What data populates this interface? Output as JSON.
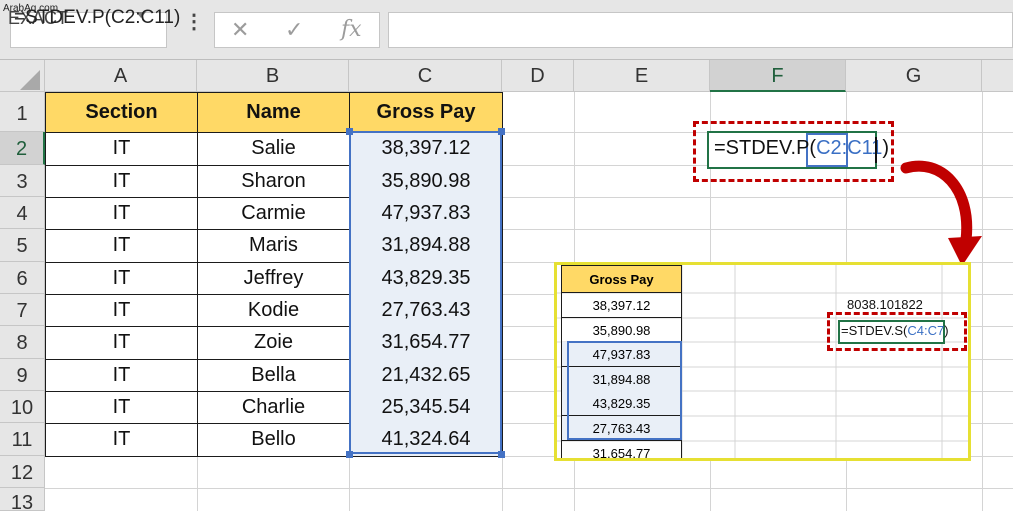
{
  "watermark": "ArabAq.com",
  "formula_bar": {
    "name_box": "EXACT",
    "cancel_icon": "✕",
    "enter_icon": "✓",
    "fx_label": "fx",
    "formula": "=STDEV.P(C2:C11)"
  },
  "columns": [
    "A",
    "B",
    "C",
    "D",
    "E",
    "F",
    "G"
  ],
  "rows": [
    "1",
    "2",
    "3",
    "4",
    "5",
    "6",
    "7",
    "8",
    "9",
    "10",
    "11",
    "12",
    "13"
  ],
  "table": {
    "headers": [
      "Section",
      "Name",
      "Gross Pay"
    ],
    "data": [
      [
        "IT",
        "Salie",
        "38,397.12"
      ],
      [
        "IT",
        "Sharon",
        "35,890.98"
      ],
      [
        "IT",
        "Carmie",
        "47,937.83"
      ],
      [
        "IT",
        "Maris",
        "31,894.88"
      ],
      [
        "IT",
        "Jeffrey",
        "43,829.35"
      ],
      [
        "IT",
        "Kodie",
        "27,763.43"
      ],
      [
        "IT",
        "Zoie",
        "31,654.77"
      ],
      [
        "IT",
        "Bella",
        "21,432.65"
      ],
      [
        "IT",
        "Charlie",
        "25,345.54"
      ],
      [
        "IT",
        "Bello",
        "41,324.64"
      ]
    ]
  },
  "active_cell": {
    "formula_prefix": "=STDEV.P(",
    "formula_ref": "C2:C11",
    "formula_suffix": ")"
  },
  "inset": {
    "header": "Gross Pay",
    "values": [
      "38,397.12",
      "35,890.98",
      "47,937.83",
      "31,894.88",
      "43,829.35",
      "27,763.43",
      "31,654.77"
    ],
    "result": "8038.101822",
    "formula_prefix": "=STDEV.S(",
    "formula_ref": "C4:C7",
    "formula_suffix": ")"
  },
  "colors": {
    "header_fill": "#ffd966",
    "selection_border": "#4472c4",
    "callout": "#c00000",
    "inset_border": "#e6e033",
    "active_cell": "#217346"
  }
}
